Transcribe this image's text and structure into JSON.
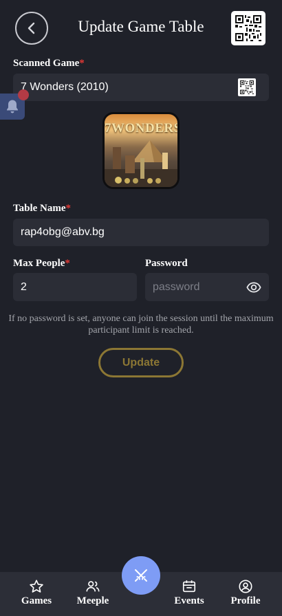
{
  "header": {
    "title": "Update Game Table",
    "back_icon": "chevron-left-icon",
    "qr_icon": "qr-code-icon"
  },
  "form": {
    "scanned_game": {
      "label": "Scanned Game",
      "required_mark": "*",
      "value": "7 Wonders (2010)"
    },
    "game_image": {
      "logo_text": "7WONDERS"
    },
    "table_name": {
      "label": "Table Name",
      "required_mark": "*",
      "value": "rap4obg@abv.bg"
    },
    "max_people": {
      "label": "Max People",
      "required_mark": "*",
      "value": "2"
    },
    "password": {
      "label": "Password",
      "placeholder": "password",
      "value": ""
    },
    "hint": "If no password is set, anyone can join the session until the maximum participant limit is reached.",
    "update_label": "Update"
  },
  "nav": {
    "items": [
      {
        "label": "Games",
        "icon": "star-icon"
      },
      {
        "label": "Meeple",
        "icon": "users-icon"
      },
      {
        "label": "Events",
        "icon": "calendar-icon"
      },
      {
        "label": "Profile",
        "icon": "user-circle-icon"
      }
    ],
    "center_icon": "crossed-swords-icon"
  },
  "colors": {
    "background": "#1f2129",
    "field": "#2b2d36",
    "required": "#e53935",
    "update_accent": "#8c7734",
    "nav_center": "#7e9cf5",
    "notification": "#3a4a78"
  }
}
